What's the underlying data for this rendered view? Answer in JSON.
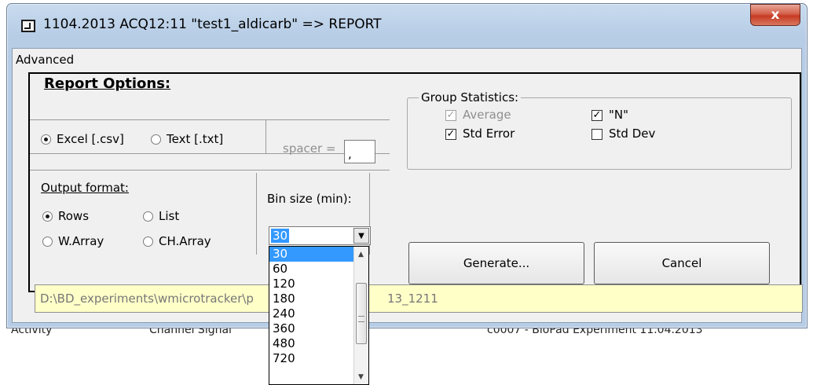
{
  "window": {
    "title": "1104.2013 ACQ12:11 \"test1_aldicarb\" => REPORT",
    "close_label": "x"
  },
  "menu": {
    "advanced": "Advanced"
  },
  "report": {
    "title": "Report Options:",
    "format_excel": "Excel [.csv]",
    "format_text": "Text [.txt]",
    "spacer_label": "spacer =",
    "spacer_value": ",",
    "selected_file_format": "Excel [.csv]"
  },
  "group_stats": {
    "legend": "Group Statistics:",
    "average": "Average",
    "n": "\"N\"",
    "std_error": "Std Error",
    "std_dev": "Std Dev",
    "checked": {
      "average": true,
      "n": true,
      "std_error": true,
      "std_dev": false
    },
    "average_enabled": false
  },
  "output": {
    "label": "Output format:",
    "rows": "Rows",
    "list": "List",
    "w_array": "W.Array",
    "ch_array": "CH.Array",
    "selected": "Rows"
  },
  "bin": {
    "label": "Bin size (min):",
    "value": "30",
    "options": [
      "30",
      "60",
      "120",
      "180",
      "240",
      "360",
      "480",
      "720"
    ]
  },
  "buttons": {
    "generate": "Generate...",
    "cancel": "Cancel"
  },
  "path_left": "D:\\BD_experiments\\wmicrotracker\\p",
  "path_right": "13_1211",
  "background": {
    "col1": "Activity",
    "col2": "Channel Signal",
    "col3": "c0007 - BioPad Experiment 11.04.2013"
  }
}
